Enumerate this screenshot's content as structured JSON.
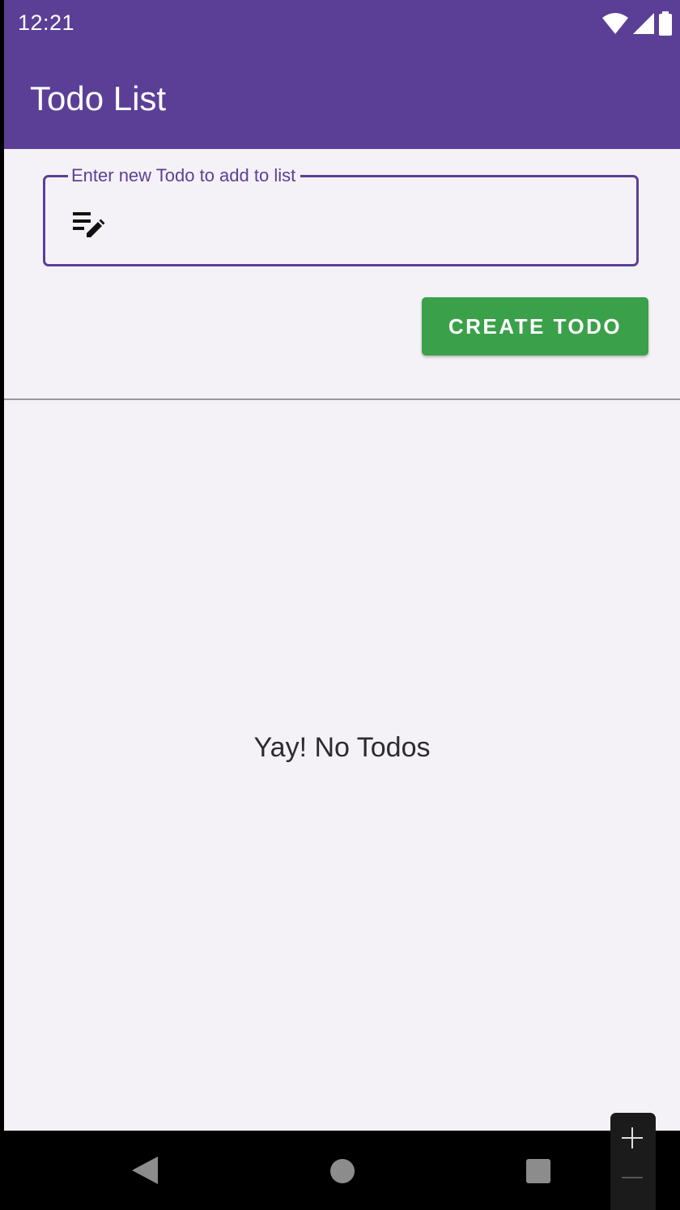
{
  "status_bar": {
    "time": "12:21",
    "icons": [
      "wifi-icon",
      "signal-icon",
      "battery-icon"
    ]
  },
  "app_bar": {
    "title": "Todo List",
    "color": "#5b3f97"
  },
  "todo_input": {
    "label": "Enter new Todo to add to list",
    "value": "",
    "icon": "edit-note-icon"
  },
  "create_button": {
    "label": "CREATE TODO",
    "color": "#3ba04a"
  },
  "empty_state": {
    "message": "Yay! No Todos"
  },
  "nav_bar": {
    "icons": [
      "back-icon",
      "home-icon",
      "recents-icon"
    ]
  },
  "zoom_controls": {
    "icons": [
      "zoom-in-icon",
      "zoom-out-icon"
    ]
  }
}
